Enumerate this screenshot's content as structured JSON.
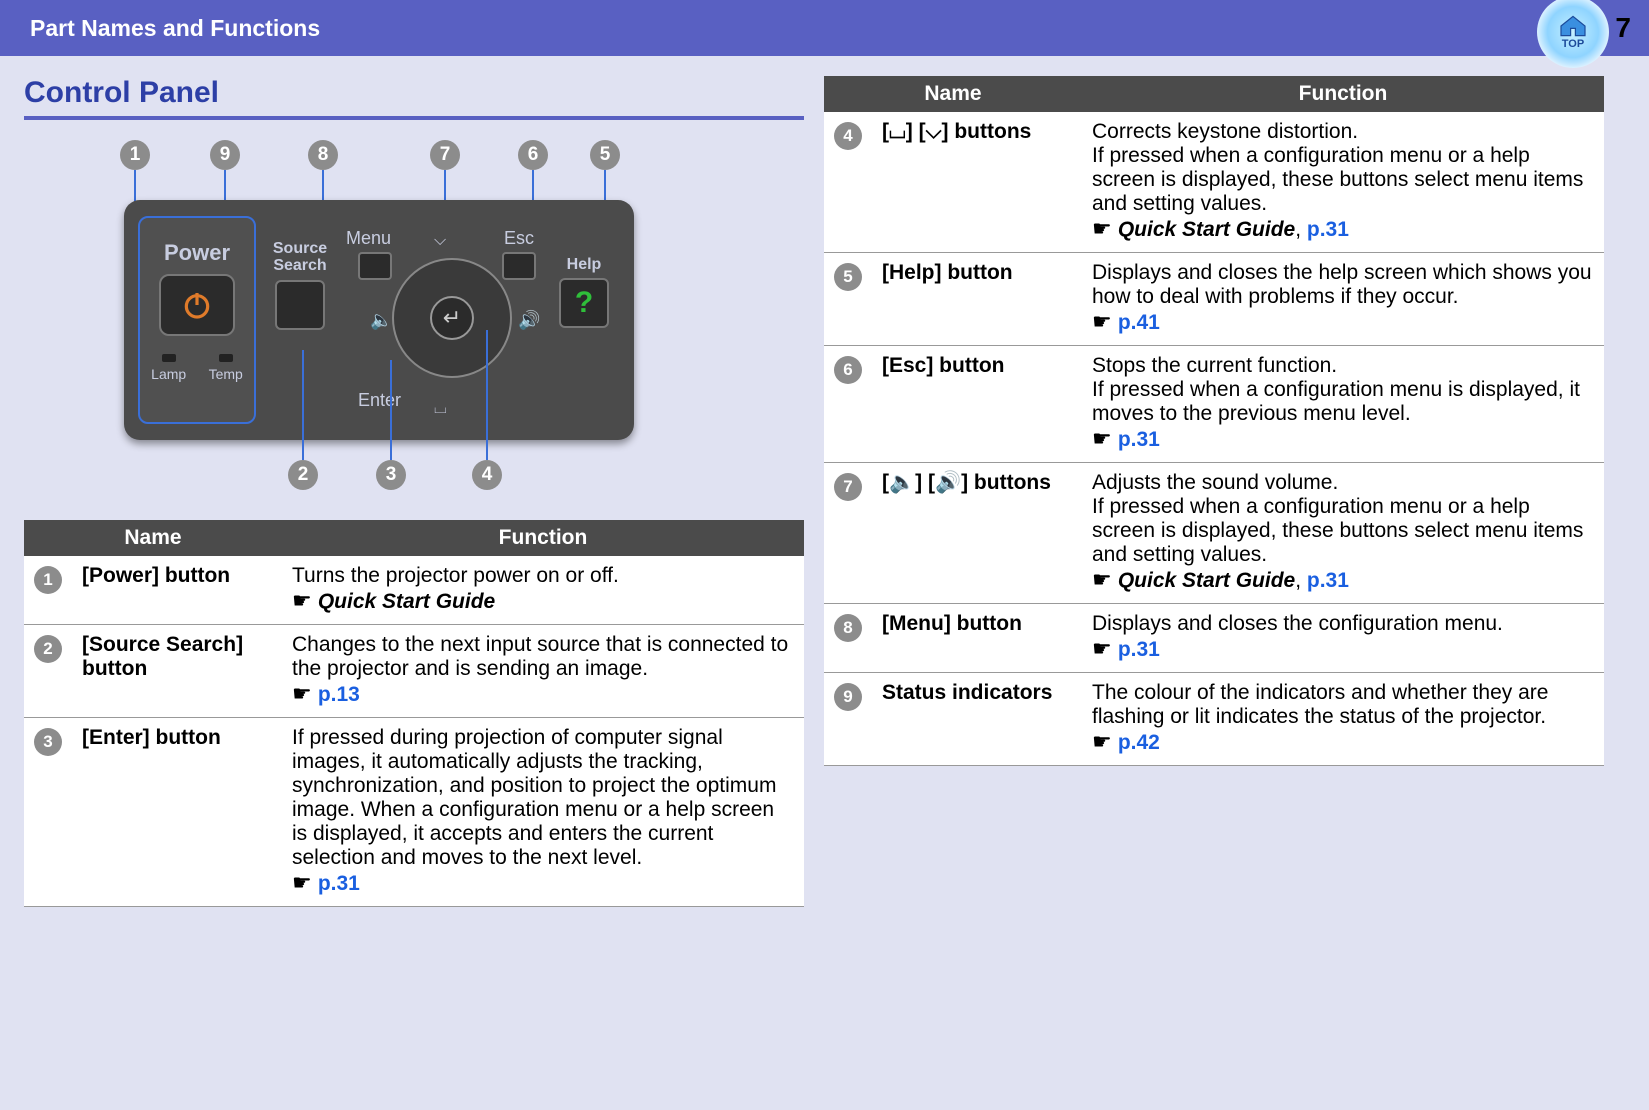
{
  "header": {
    "title": "Part Names and Functions",
    "page": "7",
    "top_label": "TOP"
  },
  "section": {
    "title": "Control Panel"
  },
  "panel": {
    "power": "Power",
    "lamp": "Lamp",
    "temp": "Temp",
    "source": "Source\nSearch",
    "menu": "Menu",
    "esc": "Esc",
    "help": "Help",
    "enter": "Enter"
  },
  "th": {
    "name": "Name",
    "func": "Function"
  },
  "rows_left": [
    {
      "n": "1",
      "name": "[Power] button",
      "func": "Turns the projector power on or off.",
      "ref": "Quick Start Guide",
      "link": ""
    },
    {
      "n": "2",
      "name": "[Source Search] button",
      "func": "Changes to the next input source that is connected to the projector and is sending an image.",
      "ref": "",
      "link": "p.13"
    },
    {
      "n": "3",
      "name": "[Enter] button",
      "func": "If pressed during projection of computer signal images, it automatically adjusts the tracking, synchronization, and position to project the optimum image. When a configuration menu or a help screen is displayed, it accepts and enters the current selection and moves to the next level.",
      "ref": "",
      "link": "p.31"
    }
  ],
  "rows_right": [
    {
      "n": "4",
      "name": "[⌴] [⌵] buttons",
      "func": "Corrects keystone distortion.\nIf pressed when a configuration menu or a help screen is displayed, these buttons select menu items and setting values.",
      "ref": "Quick Start Guide",
      "link": "p.31",
      "comma": ", "
    },
    {
      "n": "5",
      "name": "[Help] button",
      "func": "Displays and closes the help screen which shows you how to deal with problems if they occur.",
      "ref": "",
      "link": "p.41"
    },
    {
      "n": "6",
      "name": "[Esc] button",
      "func": "Stops the current function.\nIf pressed when a configuration menu is displayed, it moves to the previous menu level.",
      "ref": "",
      "link": "p.31"
    },
    {
      "n": "7",
      "name": "[🔈] [🔊] buttons",
      "func": "Adjusts the sound volume.\nIf pressed when a configuration menu or a help screen is displayed, these buttons select menu items and setting values.",
      "ref": "Quick Start Guide",
      "link": "p.31",
      "comma": ", "
    },
    {
      "n": "8",
      "name": "[Menu] button",
      "func": "Displays and closes the configuration menu.",
      "ref": "",
      "link": "p.31"
    },
    {
      "n": "9",
      "name": "Status indicators",
      "func": "The colour of the indicators and whether they are flashing or lit indicates the status of the projector.",
      "ref": "",
      "link": "p.42"
    }
  ]
}
